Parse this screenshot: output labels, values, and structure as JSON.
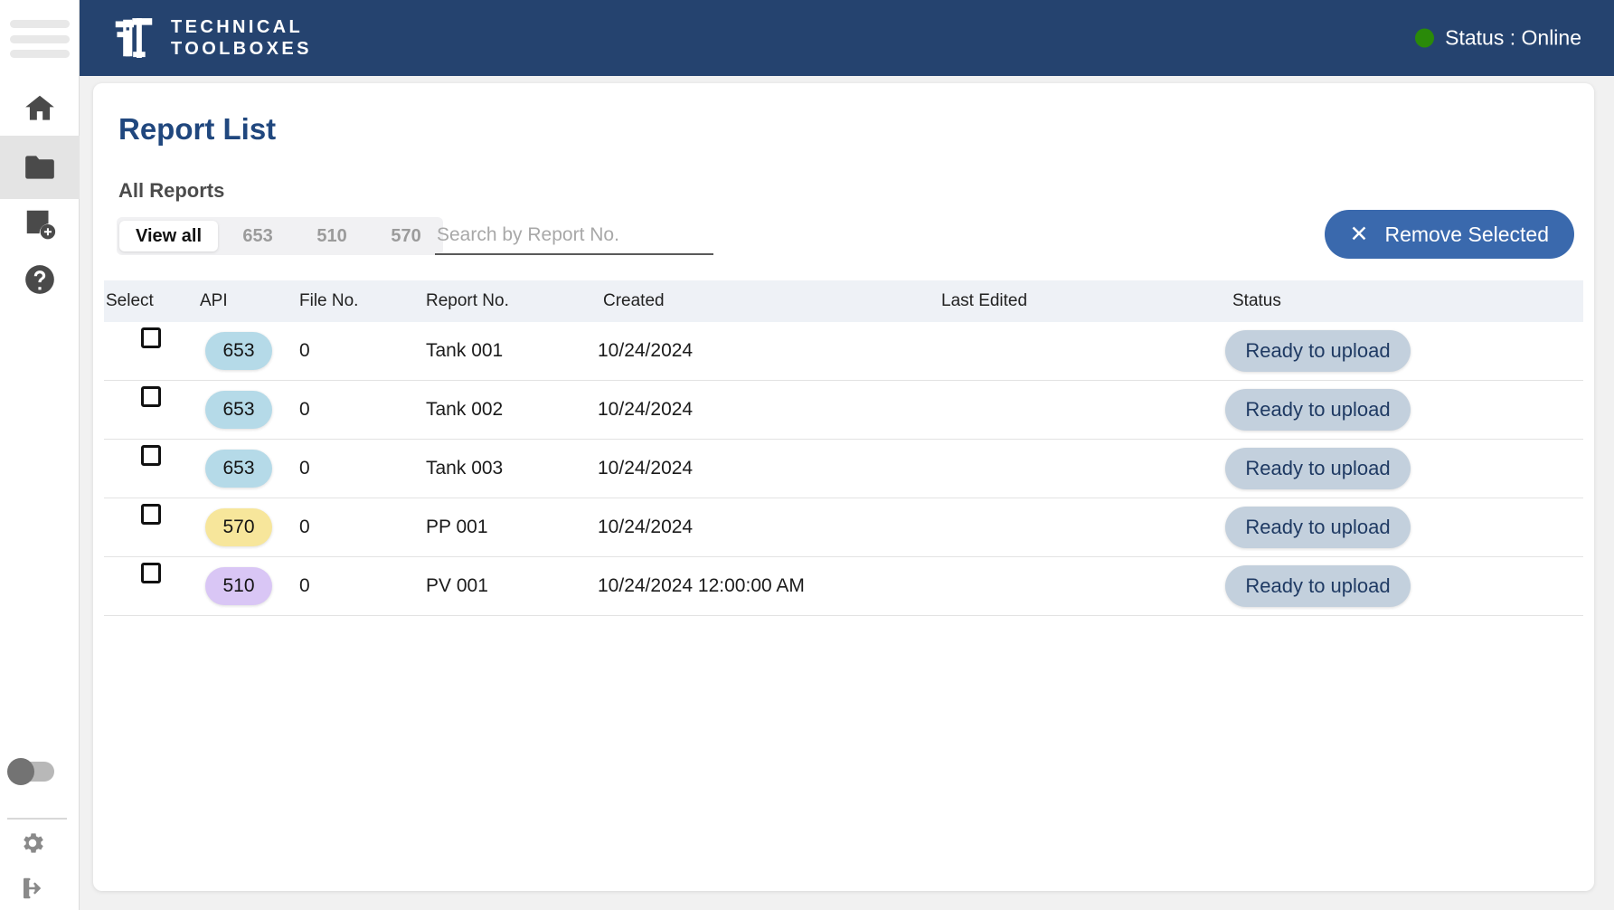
{
  "header": {
    "logo_line1": "TECHNICAL",
    "logo_line2": "TOOLBOXES",
    "status_label": "Status : Online",
    "status_color": "#2a8a09",
    "bar_color": "#25436f"
  },
  "sidebar": {
    "items": [
      {
        "name": "menu-toggle",
        "icon": "hamburger-icon",
        "active": false
      },
      {
        "name": "home",
        "icon": "home-icon",
        "active": false
      },
      {
        "name": "reports",
        "icon": "folder-icon",
        "active": true
      },
      {
        "name": "new-report",
        "icon": "new-report-icon",
        "active": false
      },
      {
        "name": "help",
        "icon": "help-circle-icon",
        "active": false
      }
    ],
    "bottom_items": [
      {
        "name": "theme-toggle",
        "icon": "toggle-switch-icon"
      },
      {
        "name": "settings",
        "icon": "gear-icon"
      },
      {
        "name": "logout",
        "icon": "logout-icon"
      }
    ]
  },
  "main": {
    "page_title": "Report List",
    "section_title": "All Reports",
    "tabs": [
      {
        "label": "View all",
        "active": true
      },
      {
        "label": "653",
        "active": false
      },
      {
        "label": "510",
        "active": false
      },
      {
        "label": "570",
        "active": false
      }
    ],
    "search": {
      "placeholder": "Search by Report No.",
      "value": ""
    },
    "remove_button": {
      "label": "Remove Selected",
      "icon": "close-x-icon",
      "color": "#3a69ad"
    },
    "table": {
      "columns": [
        "Select",
        "API",
        "File No.",
        "Report No.",
        "Created",
        "Last Edited",
        "Status"
      ],
      "rows": [
        {
          "selected": false,
          "api": "653",
          "api_color": "#b5dae8",
          "file_no": "0",
          "report_no": "Tank 001",
          "created": "10/24/2024",
          "last_edited": "",
          "status": "Ready to upload"
        },
        {
          "selected": false,
          "api": "653",
          "api_color": "#b5dae8",
          "file_no": "0",
          "report_no": "Tank 002",
          "created": "10/24/2024",
          "last_edited": "",
          "status": "Ready to upload"
        },
        {
          "selected": false,
          "api": "653",
          "api_color": "#b5dae8",
          "file_no": "0",
          "report_no": "Tank 003",
          "created": "10/24/2024",
          "last_edited": "",
          "status": "Ready to upload"
        },
        {
          "selected": false,
          "api": "570",
          "api_color": "#f7e69b",
          "file_no": "0",
          "report_no": "PP 001",
          "created": "10/24/2024",
          "last_edited": "",
          "status": "Ready to upload"
        },
        {
          "selected": false,
          "api": "510",
          "api_color": "#d9c6f5",
          "file_no": "0",
          "report_no": "PV 001",
          "created": "10/24/2024 12:00:00 AM",
          "last_edited": "",
          "status": "Ready to upload"
        }
      ]
    }
  }
}
